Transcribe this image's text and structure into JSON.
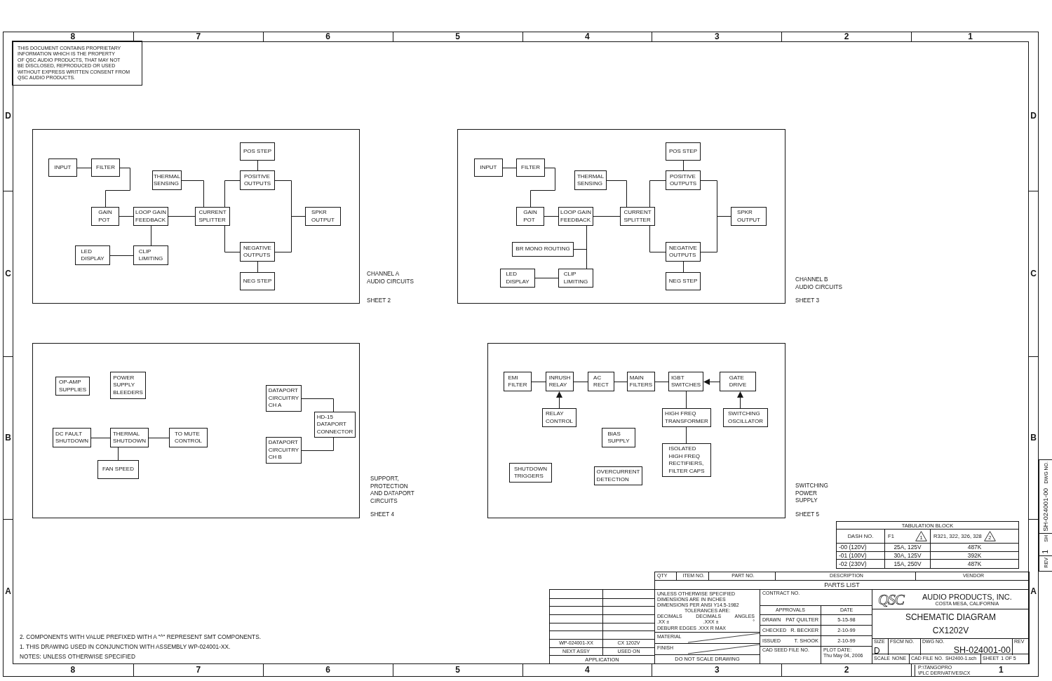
{
  "frame": {
    "top_zones": [
      "8",
      "7",
      "6",
      "5",
      "4",
      "3",
      "2",
      "1"
    ],
    "left_zones": [
      "D",
      "C",
      "B",
      "A"
    ],
    "right_zones": [
      "D",
      "C",
      "B",
      "A"
    ],
    "bottom_zones": [
      "8",
      "7",
      "6",
      "5",
      "4",
      "3",
      "2",
      "1"
    ]
  },
  "proprietary_notice": [
    "THIS DOCUMENT CONTAINS PROPRIETARY",
    "INFORMATION WHICH IS THE PROPERTY",
    "OF QSC AUDIO PRODUCTS, THAT MAY NOT",
    "BE DISCLOSED, REPRODUCED OR USED",
    "WITHOUT EXPRESS WRITTEN CONSENT FROM",
    "QSC AUDIO PRODUCTS."
  ],
  "panels": [
    {
      "caption": [
        "CHANNEL A",
        "AUDIO CIRCUITS"
      ],
      "sheet": "SHEET 2",
      "blocks": [
        {
          "lines": [
            "INPUT"
          ]
        },
        {
          "lines": [
            "FILTER"
          ]
        },
        {
          "lines": [
            "POS STEP"
          ]
        },
        {
          "lines": [
            "THERMAL",
            "SENSING"
          ]
        },
        {
          "lines": [
            "POSITIVE",
            "OUTPUTS"
          ]
        },
        {
          "lines": [
            "GAIN",
            "POT"
          ]
        },
        {
          "lines": [
            "LOOP GAIN",
            "FEEDBACK"
          ]
        },
        {
          "lines": [
            "CURRENT",
            "SPLITTER"
          ]
        },
        {
          "lines": [
            "SPKR",
            "OUTPUT"
          ]
        },
        {
          "lines": [
            "LED",
            "DISPLAY"
          ]
        },
        {
          "lines": [
            "CLIP",
            "LIMITING"
          ]
        },
        {
          "lines": [
            "NEGATIVE",
            "OUTPUTS"
          ]
        },
        {
          "lines": [
            "NEG STEP"
          ]
        }
      ]
    },
    {
      "caption": [
        "CHANNEL B",
        "AUDIO CIRCUITS"
      ],
      "sheet": "SHEET 3",
      "blocks": [
        {
          "lines": [
            "INPUT"
          ]
        },
        {
          "lines": [
            "FILTER"
          ]
        },
        {
          "lines": [
            "POS STEP"
          ]
        },
        {
          "lines": [
            "THERMAL",
            "SENSING"
          ]
        },
        {
          "lines": [
            "POSITIVE",
            "OUTPUTS"
          ]
        },
        {
          "lines": [
            "GAIN",
            "POT"
          ]
        },
        {
          "lines": [
            "LOOP GAIN",
            "FEEDBACK"
          ]
        },
        {
          "lines": [
            "CURRENT",
            "SPLITTER"
          ]
        },
        {
          "lines": [
            "SPKR",
            "OUTPUT"
          ]
        },
        {
          "lines": [
            "BR MONO ROUTING"
          ]
        },
        {
          "lines": [
            "LED",
            "DISPLAY"
          ]
        },
        {
          "lines": [
            "CLIP",
            "LIMITING"
          ]
        },
        {
          "lines": [
            "NEGATIVE",
            "OUTPUTS"
          ]
        },
        {
          "lines": [
            "NEG STEP"
          ]
        }
      ]
    },
    {
      "caption": [
        "SUPPORT,",
        "PROTECTION",
        "AND DATAPORT",
        "CIRCUITS"
      ],
      "sheet": "SHEET 4",
      "blocks": [
        {
          "lines": [
            "OP-AMP",
            "SUPPLIES"
          ]
        },
        {
          "lines": [
            "POWER",
            "SUPPLY",
            "BLEEDERS"
          ]
        },
        {
          "lines": [
            "DATAPORT",
            "CIRCUITRY",
            "CH A"
          ]
        },
        {
          "lines": [
            "HD-15",
            "DATAPORT",
            "CONNECTOR"
          ]
        },
        {
          "lines": [
            "DC FAULT",
            "SHUTDOWN"
          ]
        },
        {
          "lines": [
            "THERMAL",
            "SHUTDOWN"
          ]
        },
        {
          "lines": [
            "TO MUTE",
            "CONTROL"
          ]
        },
        {
          "lines": [
            "DATAPORT",
            "CIRCUITRY",
            "CH B"
          ]
        },
        {
          "lines": [
            "FAN SPEED"
          ]
        }
      ]
    },
    {
      "caption": [
        "SWITCHING",
        "POWER",
        "SUPPLY"
      ],
      "sheet": "SHEET 5",
      "blocks": [
        {
          "lines": [
            "EMI",
            "FILTER"
          ]
        },
        {
          "lines": [
            "INRUSH",
            "RELAY"
          ]
        },
        {
          "lines": [
            "AC",
            "RECT"
          ]
        },
        {
          "lines": [
            "MAIN",
            "FILTERS"
          ]
        },
        {
          "lines": [
            "IGBT",
            "SWITCHES"
          ]
        },
        {
          "lines": [
            "GATE",
            "DRIVE"
          ]
        },
        {
          "lines": [
            "RELAY",
            "CONTROL"
          ]
        },
        {
          "lines": [
            "HIGH FREQ",
            "TRANSFORMER"
          ]
        },
        {
          "lines": [
            "SWITCHING",
            "OSCILLATOR"
          ]
        },
        {
          "lines": [
            "BIAS",
            "SUPPLY"
          ]
        },
        {
          "lines": [
            "ISOLATED",
            "HIGH FREQ",
            "RECTIFIERS,",
            "FILTER CAPS"
          ]
        },
        {
          "lines": [
            "SHUTDOWN",
            "TRIGGERS"
          ]
        },
        {
          "lines": [
            "OVERCURRENT",
            "DETECTION"
          ]
        }
      ]
    }
  ],
  "tabulation_block": {
    "title": "TABULATION BLOCK",
    "columns": [
      {
        "label": "DASH NO."
      },
      {
        "label": "F1",
        "revision": "1"
      },
      {
        "label": "R321, 322, 326, 328",
        "revision": "2"
      }
    ],
    "rows": [
      [
        "-00 (120V)",
        "25A, 125V",
        "487K"
      ],
      [
        "-01 (100V)",
        "30A, 125V",
        "392K"
      ],
      [
        "-02 (230V)",
        "15A, 250V",
        "487K"
      ]
    ]
  },
  "side_tab": {
    "dwg_label": "DWG NO.",
    "dwg_no": "SH-024001-00",
    "sheet": "1",
    "sheet_label": "SH",
    "rev_label": "REV"
  },
  "parts_list": {
    "columns": [
      "QTY",
      "ITEM NO.",
      "PART NO.",
      "DESCRIPTION",
      "VENDOR"
    ],
    "title": "PARTS LIST"
  },
  "notes": [
    "2. COMPONENTS WITH VALUE PREFIXED WITH A \"^\" REPRESENT SMT COMPONENTS.",
    "1. THIS DRAWING USED IN CONJUNCTION WITH ASSEMBLY WP-024001-XX.",
    "NOTES: UNLESS OTHERWISE SPECIFIED"
  ],
  "application": {
    "rows": [
      [
        "WP-024001-XX",
        "CX 1202V"
      ]
    ],
    "headers": [
      "NEXT ASSY",
      "USED ON"
    ],
    "title": "APPLICATION"
  },
  "tolerances": {
    "lines": [
      "UNLESS OTHERWISE SPECIFIED",
      "DIMENSIONS ARE IN INCHES",
      "DIMENSIONS PER ANSI Y14.5-1982"
    ],
    "heading": "TOLERANCES ARE:",
    "labels": [
      "DECIMALS",
      "DECIMALS",
      "ANGLES"
    ],
    "values": [
      ".XX ±",
      ".XXX ±",
      "°"
    ],
    "deburr": "DEBURR EDGES .XXX R MAX",
    "material": "MATERIAL",
    "finish": "FINISH",
    "scale_note": "DO NOT SCALE DRAWING"
  },
  "approvals": {
    "contract_label": "CONTRACT NO.",
    "headers": [
      "APPROVALS",
      "DATE"
    ],
    "rows": [
      {
        "role": "DRAWN",
        "name": "PAT QUILTER",
        "date": "5-15-98"
      },
      {
        "role": "CHECKED",
        "name": "R. BECKER",
        "date": "2-10-99"
      },
      {
        "role": "ISSUED",
        "name": "T. SHOOK",
        "date": "2-10-99"
      }
    ],
    "cad_seed_label": "CAD SEED FILE NO.",
    "plot_date_label": "PLOT DATE:",
    "plot_date": "Thu May 04, 2006"
  },
  "company": {
    "logo": "QSC",
    "name": "AUDIO PRODUCTS, INC.",
    "location": "COSTA MESA, CALIFORNIA"
  },
  "drawing": {
    "title": "SCHEMATIC DIAGRAM",
    "model": "CX1202V",
    "size_label": "SIZE",
    "size": "D",
    "fscm_label": "FSCM NO.",
    "dwg_label": "DWG NO.",
    "dwg_no": "SH-024001-00",
    "rev_label": "REV",
    "scale_label": "SCALE",
    "scale": "NONE",
    "cad_file_label": "CAD FILE NO.",
    "cad_file": "SH2400-1.sch",
    "sheet_label": "SHEET",
    "sheet": "1 OF 5"
  },
  "file_path": [
    "P:\\TANGOPRO",
    "\\PLC DERIVATIVES\\CX"
  ]
}
